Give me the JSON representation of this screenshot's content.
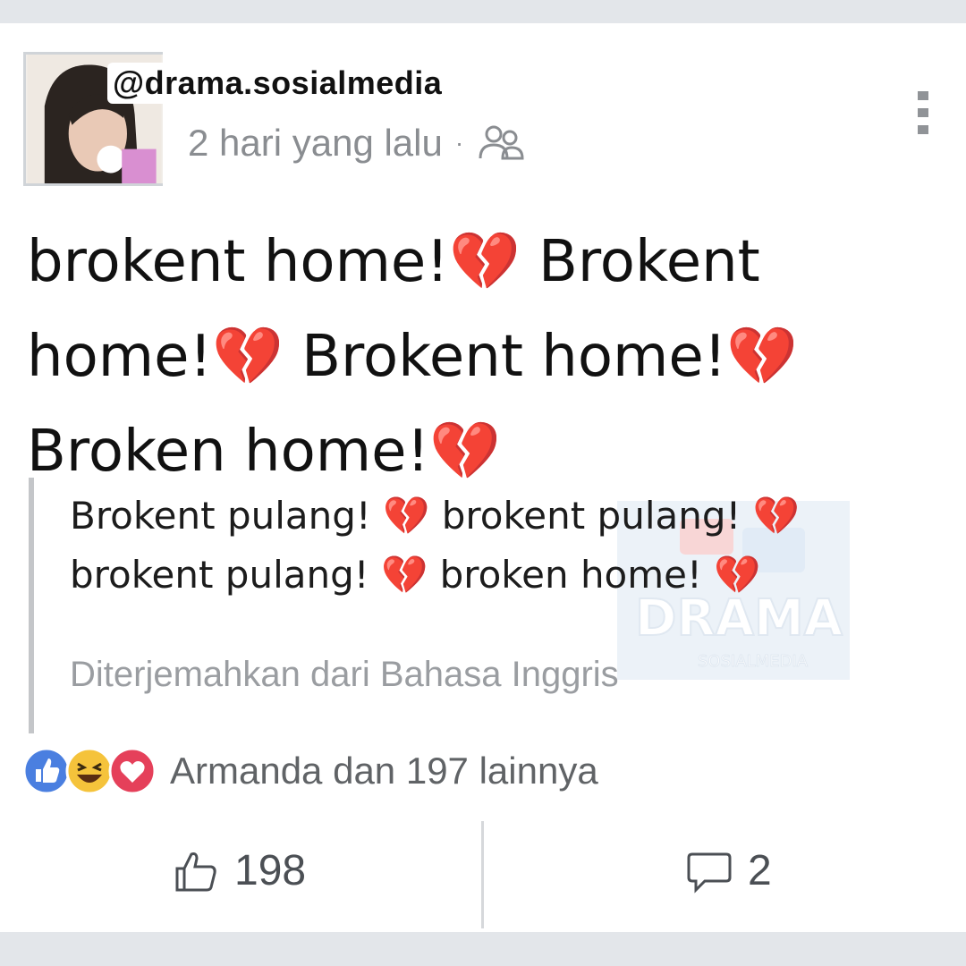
{
  "watermark": {
    "handle": "@drama.sosialmedia"
  },
  "post": {
    "timestamp": "2 hari yang lalu",
    "separator": "·",
    "privacy_icon": "friends-icon",
    "text": "brokent home!💔 Brokent\nhome!💔 Brokent home!💔\nBroken home!💔"
  },
  "translation": {
    "text": "Brokent pulang! 💔 brokent pulang! 💔\nbrokent pulang! 💔 broken home! 💔",
    "label": "Diterjemahkan dari Bahasa Inggris"
  },
  "reactions": {
    "icons": [
      "like-reaction-icon",
      "haha-reaction-icon",
      "love-reaction-icon"
    ],
    "summary": "Armanda dan 197 lainnya"
  },
  "actions": {
    "like_count": "198",
    "comment_count": "2"
  },
  "colors": {
    "like_blue": "#4a7fe0",
    "love_red": "#e5405a",
    "haha_yellow": "#f5c33b"
  }
}
